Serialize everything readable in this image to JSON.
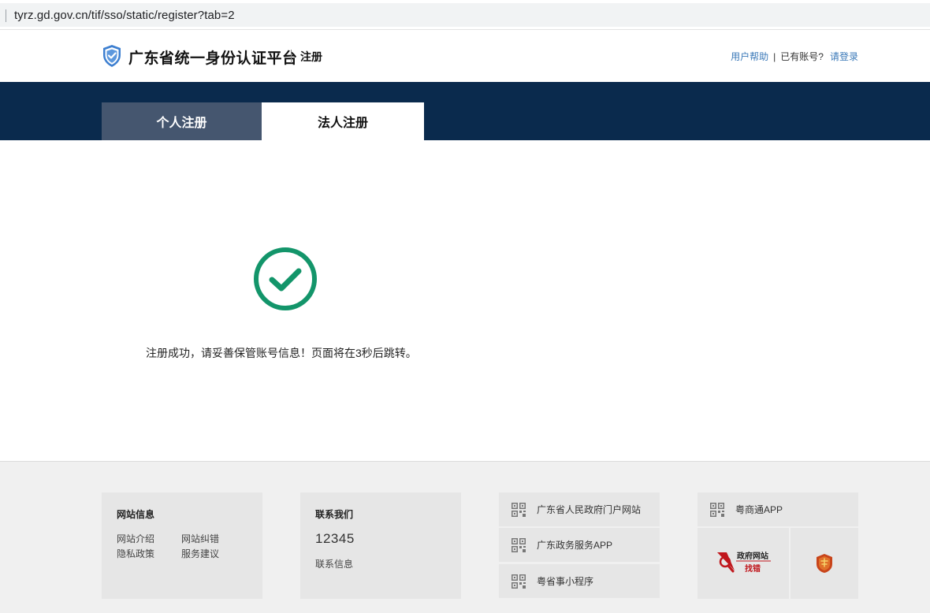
{
  "browser": {
    "url": "tyrz.gd.gov.cn/tif/sso/static/register?tab=2"
  },
  "header": {
    "site_title": "广东省统一身份认证平台",
    "sub_title": "注册",
    "help_link": "用户帮助",
    "separator": "|",
    "has_account": "已有账号?",
    "login_link": "请登录"
  },
  "tabs": [
    {
      "label": "个人注册",
      "active": false
    },
    {
      "label": "法人注册",
      "active": true
    }
  ],
  "success": {
    "message": "注册成功，请妥善保管账号信息！页面将在3秒后跳转。",
    "color": "#13956a"
  },
  "footer": {
    "site_info": {
      "title": "网站信息",
      "links": [
        "网站介绍",
        "网站纠错",
        "隐私政策",
        "服务建议"
      ]
    },
    "contact": {
      "title": "联系我们",
      "phone": "12345",
      "link": "联系信息"
    },
    "qr_links": [
      {
        "label": "广东省人民政府门户网站",
        "icon": "qr-code-icon"
      },
      {
        "label": "广东政务服务APP",
        "icon": "qr-code-icon"
      },
      {
        "label": "粤省事小程序",
        "icon": "qr-code-icon"
      },
      {
        "label": "粤商通APP",
        "icon": "qr-code-icon"
      }
    ],
    "badges": {
      "gov_site_text_top": "政府网站",
      "gov_site_text_bottom": "找错"
    }
  },
  "colors": {
    "nav_band": "#0a2a4d",
    "tab_inactive": "#45566f",
    "link_blue": "#3b79b8",
    "logo_blue": "#3d7fd0"
  }
}
